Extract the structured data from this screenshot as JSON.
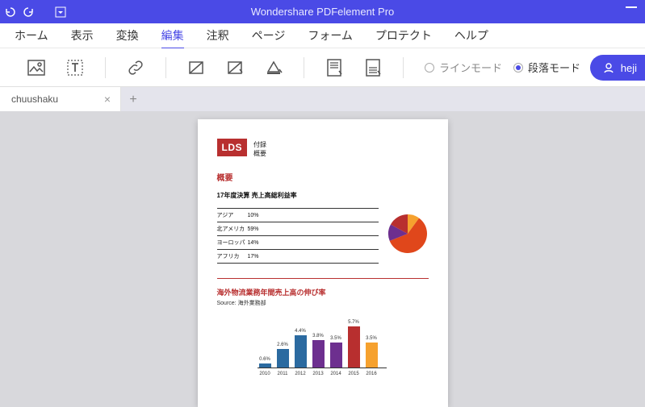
{
  "app": {
    "title": "Wondershare PDFelement Pro"
  },
  "menu": {
    "home": "ホーム",
    "view": "表示",
    "convert": "変換",
    "edit": "編集",
    "comment": "注釈",
    "page": "ページ",
    "form": "フォーム",
    "protect": "プロテクト",
    "help": "ヘルプ",
    "active": "edit"
  },
  "toolbar": {
    "mode_line": "ラインモード",
    "mode_para": "段落モード",
    "selected_mode": "para"
  },
  "user": {
    "name": "heji"
  },
  "tabs": {
    "items": [
      {
        "name": "chuushaku"
      }
    ]
  },
  "doc": {
    "logo": "LDS",
    "header_line1": "付録",
    "header_line2": "概要",
    "section_title": "概要",
    "chart1_title": "17年度決算 売上高総利益率",
    "chart2_title": "海外物流業務年間売上高の伸び率",
    "chart2_source": "Source: 海外業務部"
  },
  "chart_data": [
    {
      "type": "pie",
      "title": "17年度決算 売上高総利益率",
      "series": [
        {
          "name": "アジア",
          "value": 10,
          "label": "10%",
          "color": "#f6a12e"
        },
        {
          "name": "北アメリカ",
          "value": 59,
          "label": "59%",
          "color": "#e0471b"
        },
        {
          "name": "ヨーロッパ",
          "value": 14,
          "label": "14%",
          "color": "#6d2f8f"
        },
        {
          "name": "アフリカ",
          "value": 17,
          "label": "17%",
          "color": "#b82f2f"
        }
      ]
    },
    {
      "type": "bar",
      "title": "海外物流業務年間売上高の伸び率",
      "source": "Source: 海外業務部",
      "categories": [
        "2010",
        "2011",
        "2012",
        "2013",
        "2014",
        "2015",
        "2016"
      ],
      "values": [
        0.6,
        2.6,
        4.4,
        3.8,
        3.5,
        5.7,
        3.5
      ],
      "value_labels": [
        "0.6%",
        "2.6%",
        "4.4%",
        "3.8%",
        "3.5%",
        "5.7%",
        "3.5%"
      ],
      "colors": [
        "#2b6aa0",
        "#2b6aa0",
        "#2b6aa0",
        "#6d2f8f",
        "#6d2f8f",
        "#b82f2f",
        "#f6a12e"
      ],
      "ylim": [
        0,
        6
      ]
    }
  ]
}
